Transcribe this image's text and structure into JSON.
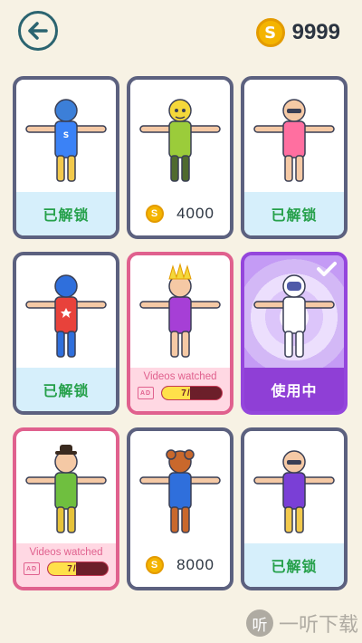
{
  "header": {
    "coins": "9999",
    "coin_symbol": "S"
  },
  "cards": [
    {
      "status": "已解锁",
      "kind": "unlocked",
      "character": "blue-helmet-s",
      "colors": {
        "head": "#3c7fd8",
        "body": "#3b82f6",
        "legs": "#f2c94c"
      }
    },
    {
      "status": "4000",
      "kind": "price",
      "character": "yellow-face-green",
      "colors": {
        "head": "#f4d83a",
        "body": "#9bcc3a",
        "legs": "#4f6a2e"
      }
    },
    {
      "status": "已解锁",
      "kind": "unlocked",
      "character": "pink-sunglasses",
      "colors": {
        "head": "#f5c9a5",
        "body": "#ff6fa0",
        "legs": "#f5c9a5"
      }
    },
    {
      "status": "已解锁",
      "kind": "unlocked",
      "character": "captain-hero",
      "colors": {
        "head": "#2f6fdc",
        "body": "#e8423b",
        "legs": "#2f6fdc"
      }
    },
    {
      "status": "Videos watched",
      "kind": "video",
      "character": "carnival-dancer",
      "progress_text": "7/15",
      "progress_value": 7,
      "progress_max": 15,
      "ad_label": "AD",
      "colors": {
        "head": "#f5c9a5",
        "body": "#a63fd6",
        "legs": "#f5c9a5"
      }
    },
    {
      "status": "使用中",
      "kind": "using",
      "character": "white-astronaut",
      "colors": {
        "head": "#ffffff",
        "body": "#ffffff",
        "legs": "#ffffff"
      }
    },
    {
      "status": "Videos watched",
      "kind": "video",
      "character": "bowler-hat-green",
      "progress_text": "7/15",
      "progress_value": 7,
      "progress_max": 15,
      "ad_label": "AD",
      "colors": {
        "head": "#f5c9a5",
        "body": "#6fbf3f",
        "legs": "#e6c23a"
      }
    },
    {
      "status": "8000",
      "kind": "price",
      "character": "bear-mascot",
      "colors": {
        "head": "#c9682c",
        "body": "#2f6fdc",
        "legs": "#c9682c"
      }
    },
    {
      "status": "已解锁",
      "kind": "unlocked",
      "character": "purple-hair-sunglasses",
      "colors": {
        "head": "#f5c9a5",
        "body": "#7a3fd6",
        "legs": "#f2c94c"
      }
    }
  ],
  "watermark": {
    "icon_text": "听",
    "text": "一听下载"
  }
}
